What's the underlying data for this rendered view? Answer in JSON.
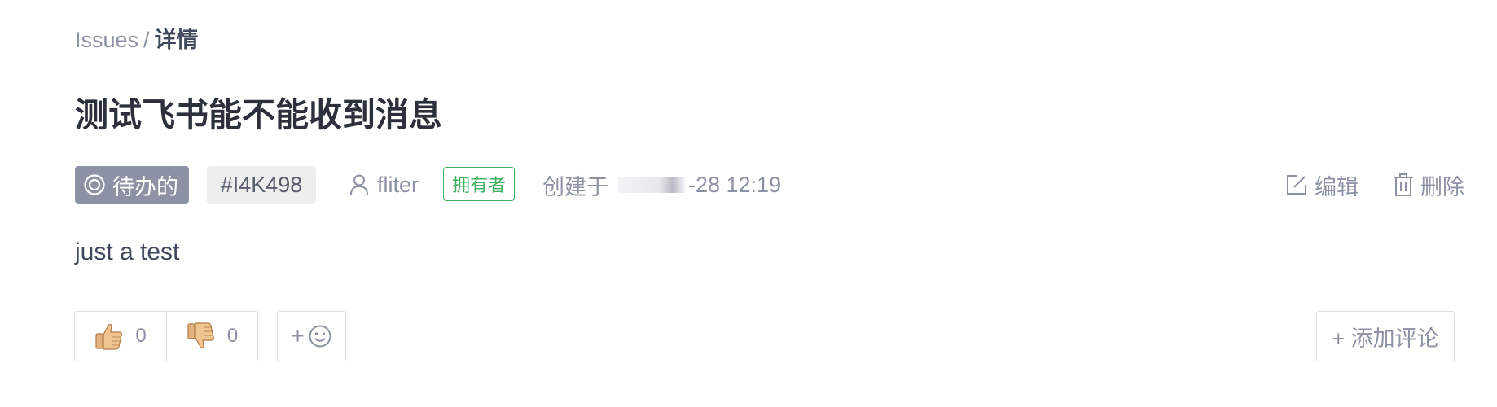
{
  "breadcrumb": {
    "root": "Issues",
    "separator": "/",
    "current": "详情"
  },
  "issue": {
    "title": "测试飞书能不能收到消息",
    "status": "待办的",
    "status_icon": "status-circle-icon",
    "id": "#I4K498",
    "author": "fliter",
    "author_icon": "user-icon",
    "owner_tag": "拥有者",
    "created_prefix": "创建于",
    "created_time": "-28 12:19",
    "body": "just a test"
  },
  "actions": {
    "edit_label": "编辑",
    "edit_icon": "edit-icon",
    "delete_label": "删除",
    "delete_icon": "trash-icon"
  },
  "reactions": {
    "thumbs_up_icon": "thumbs-up-icon",
    "thumbs_up_count": "0",
    "thumbs_down_icon": "thumbs-down-icon",
    "thumbs_down_count": "0",
    "add_reaction_label": "+",
    "add_reaction_icon": "smiley-icon"
  },
  "comment": {
    "add_label": "+ 添加评论"
  },
  "colors": {
    "status_bg": "#8c92a4",
    "owner_green": "#3fb160",
    "muted_text": "#8c92a4",
    "title_text": "#2b303b"
  }
}
